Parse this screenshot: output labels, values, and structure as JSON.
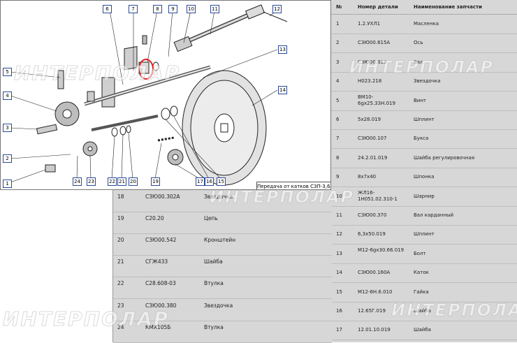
{
  "header": {
    "num": "№",
    "part_number": "Номер детали",
    "part_name": "Наименование запчасти"
  },
  "caption": "Передача от катков СЗП-3,6А",
  "watermark": "ИНТЕРПОЛАР",
  "callouts": [
    "1",
    "2",
    "3",
    "4",
    "5",
    "6",
    "7",
    "8",
    "9",
    "10",
    "11",
    "12",
    "13",
    "14",
    "15",
    "16",
    "17",
    "19",
    "20",
    "21",
    "22",
    "23",
    "24"
  ],
  "right_rows": [
    {
      "n": "1",
      "part": "1.2.УХЛ1",
      "name": "Масленка"
    },
    {
      "n": "2",
      "part": "СЗЮ00.615А",
      "name": "Ось"
    },
    {
      "n": "3",
      "part": "СЗЮ00.613",
      "name": "Вал"
    },
    {
      "n": "4",
      "part": "Н023.218",
      "name": "Звездочка"
    },
    {
      "n": "5",
      "part": "ВМ10-6gх25.33Н.019",
      "name": "Винт"
    },
    {
      "n": "6",
      "part": "5х28.019",
      "name": "Шплинт"
    },
    {
      "n": "7",
      "part": "СЗЮ00.107",
      "name": "Букса"
    },
    {
      "n": "8",
      "part": "24.2.01.019",
      "name": "Шайба регулировочная"
    },
    {
      "n": "9",
      "part": "8х7х40",
      "name": "Шпонка"
    },
    {
      "n": "10",
      "part": "ЖЛ16-1Н051.02.310-1",
      "name": "Шарнир"
    },
    {
      "n": "11",
      "part": "СЗЮ00.370",
      "name": "Вал карданный"
    },
    {
      "n": "12",
      "part": "6,3х50.019",
      "name": "Шплинт"
    },
    {
      "n": "13",
      "part": "М12-6gх30.66.019",
      "name": "Болт"
    },
    {
      "n": "14",
      "part": "СЗЮ00.160А",
      "name": "Каток"
    },
    {
      "n": "15",
      "part": "М12-6Н.6.010",
      "name": "Гайка"
    },
    {
      "n": "16",
      "part": "12.65Г.019",
      "name": "Шайба"
    },
    {
      "n": "17",
      "part": "12.01.10.019",
      "name": "Шайба"
    }
  ],
  "lower_rows": [
    {
      "n": "18",
      "part": "СЗЮ00.302А",
      "name": "Звездочка"
    },
    {
      "n": "19",
      "part": "С20.20",
      "name": "Цепь"
    },
    {
      "n": "20",
      "part": "СЗЮ00.542",
      "name": "Кронштейн"
    },
    {
      "n": "21",
      "part": "СГЖ433",
      "name": "Шайба"
    },
    {
      "n": "22",
      "part": "С28.608-03",
      "name": "Втулка"
    },
    {
      "n": "23",
      "part": "СЗЮ00.380",
      "name": "Звездочка"
    },
    {
      "n": "24",
      "part": "КМХ105Б",
      "name": "Втулка"
    }
  ]
}
